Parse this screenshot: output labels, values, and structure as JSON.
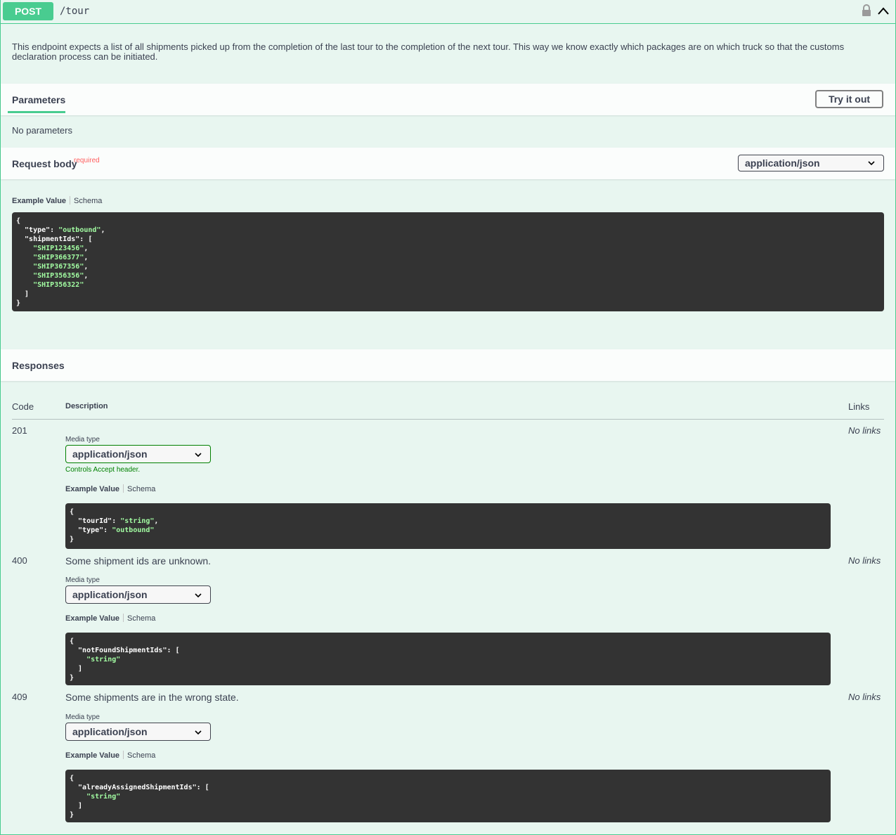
{
  "summary": {
    "method": "POST",
    "path": "/tour"
  },
  "description": "This endpoint expects a list of all shipments picked up from the completion of the last tour to the completion of the next tour. This way we know exactly which packages are on which truck so that the customs declaration process can be initiated.",
  "parameters": {
    "title": "Parameters",
    "try_label": "Try it out",
    "none_text": "No parameters"
  },
  "request_body": {
    "title": "Request body",
    "required": "required",
    "content_type": "application/json",
    "tabs": [
      "Example Value",
      "Schema"
    ],
    "example": {
      "type": "outbound",
      "shipmentIds": [
        "SHIP123456",
        "SHIP366377",
        "SHIP367356",
        "SHIP356356",
        "SHIP356322"
      ]
    }
  },
  "responses": {
    "title": "Responses",
    "headers": {
      "code": "Code",
      "description": "Description",
      "links": "Links"
    },
    "media_type_label": "Media type",
    "controls_note": "Controls Accept header.",
    "tabs": [
      "Example Value",
      "Schema"
    ],
    "items": [
      {
        "code": "201",
        "description": "",
        "media": "application/json",
        "links": "No links"
      },
      {
        "code": "400",
        "description": "Some shipment ids are unknown.",
        "media": "application/json",
        "links": "No links"
      },
      {
        "code": "409",
        "description": "Some shipments are in the wrong state.",
        "media": "application/json",
        "links": "No links"
      }
    ]
  },
  "colors": {
    "accent": "#49cc90",
    "background": "#e8f6f0",
    "code_bg": "#333333",
    "string": "#a2fca2",
    "required": "#ff6060"
  }
}
